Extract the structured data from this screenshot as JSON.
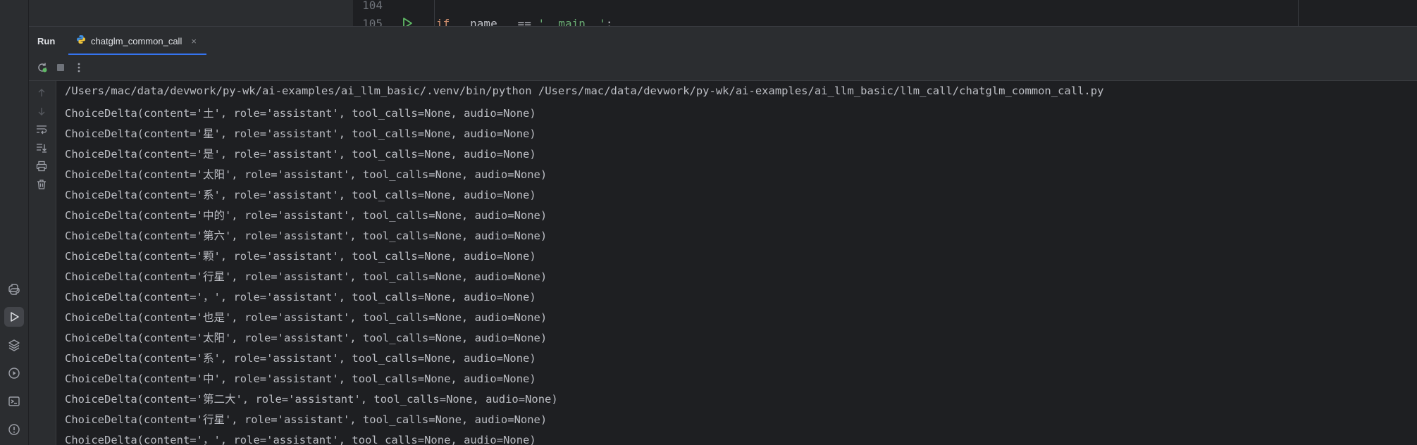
{
  "editor": {
    "line_numbers": [
      "104",
      "105"
    ],
    "code_line": {
      "kw": "if",
      "rest": " __name__ == ",
      "str": "'__main__'",
      "end": ":"
    }
  },
  "run_window": {
    "label": "Run",
    "tab": {
      "title": "chatglm_common_call",
      "close": "×"
    }
  },
  "console": {
    "lines": [
      "/Users/mac/data/devwork/py-wk/ai-examples/ai_llm_basic/.venv/bin/python /Users/mac/data/devwork/py-wk/ai-examples/ai_llm_basic/llm_call/chatglm_common_call.py",
      "ChoiceDelta(content='土', role='assistant', tool_calls=None, audio=None)",
      "ChoiceDelta(content='星', role='assistant', tool_calls=None, audio=None)",
      "ChoiceDelta(content='是', role='assistant', tool_calls=None, audio=None)",
      "ChoiceDelta(content='太阳', role='assistant', tool_calls=None, audio=None)",
      "ChoiceDelta(content='系', role='assistant', tool_calls=None, audio=None)",
      "ChoiceDelta(content='中的', role='assistant', tool_calls=None, audio=None)",
      "ChoiceDelta(content='第六', role='assistant', tool_calls=None, audio=None)",
      "ChoiceDelta(content='颗', role='assistant', tool_calls=None, audio=None)",
      "ChoiceDelta(content='行星', role='assistant', tool_calls=None, audio=None)",
      "ChoiceDelta(content='，', role='assistant', tool_calls=None, audio=None)",
      "ChoiceDelta(content='也是', role='assistant', tool_calls=None, audio=None)",
      "ChoiceDelta(content='太阳', role='assistant', tool_calls=None, audio=None)",
      "ChoiceDelta(content='系', role='assistant', tool_calls=None, audio=None)",
      "ChoiceDelta(content='中', role='assistant', tool_calls=None, audio=None)",
      "ChoiceDelta(content='第二大', role='assistant', tool_calls=None, audio=None)",
      "ChoiceDelta(content='行星', role='assistant', tool_calls=None, audio=None)",
      "ChoiceDelta(content='，', role='assistant', tool_calls=None, audio=None)"
    ]
  },
  "icons": {
    "left_strip": [
      "python-console-icon",
      "run-icon",
      "layers-icon",
      "services-icon",
      "terminal-icon",
      "problems-icon"
    ],
    "toolbar": [
      "rerun-icon",
      "stop-icon",
      "more-options-icon"
    ],
    "console_gutter": [
      "scroll-up-icon",
      "scroll-down-icon",
      "soft-wrap-icon",
      "scroll-to-end-icon",
      "print-icon",
      "clear-all-icon"
    ]
  },
  "colors": {
    "accent": "#3574f0",
    "run_green": "#5fb865",
    "rerun_green": "#5fb865",
    "text": "#bcbec4"
  }
}
